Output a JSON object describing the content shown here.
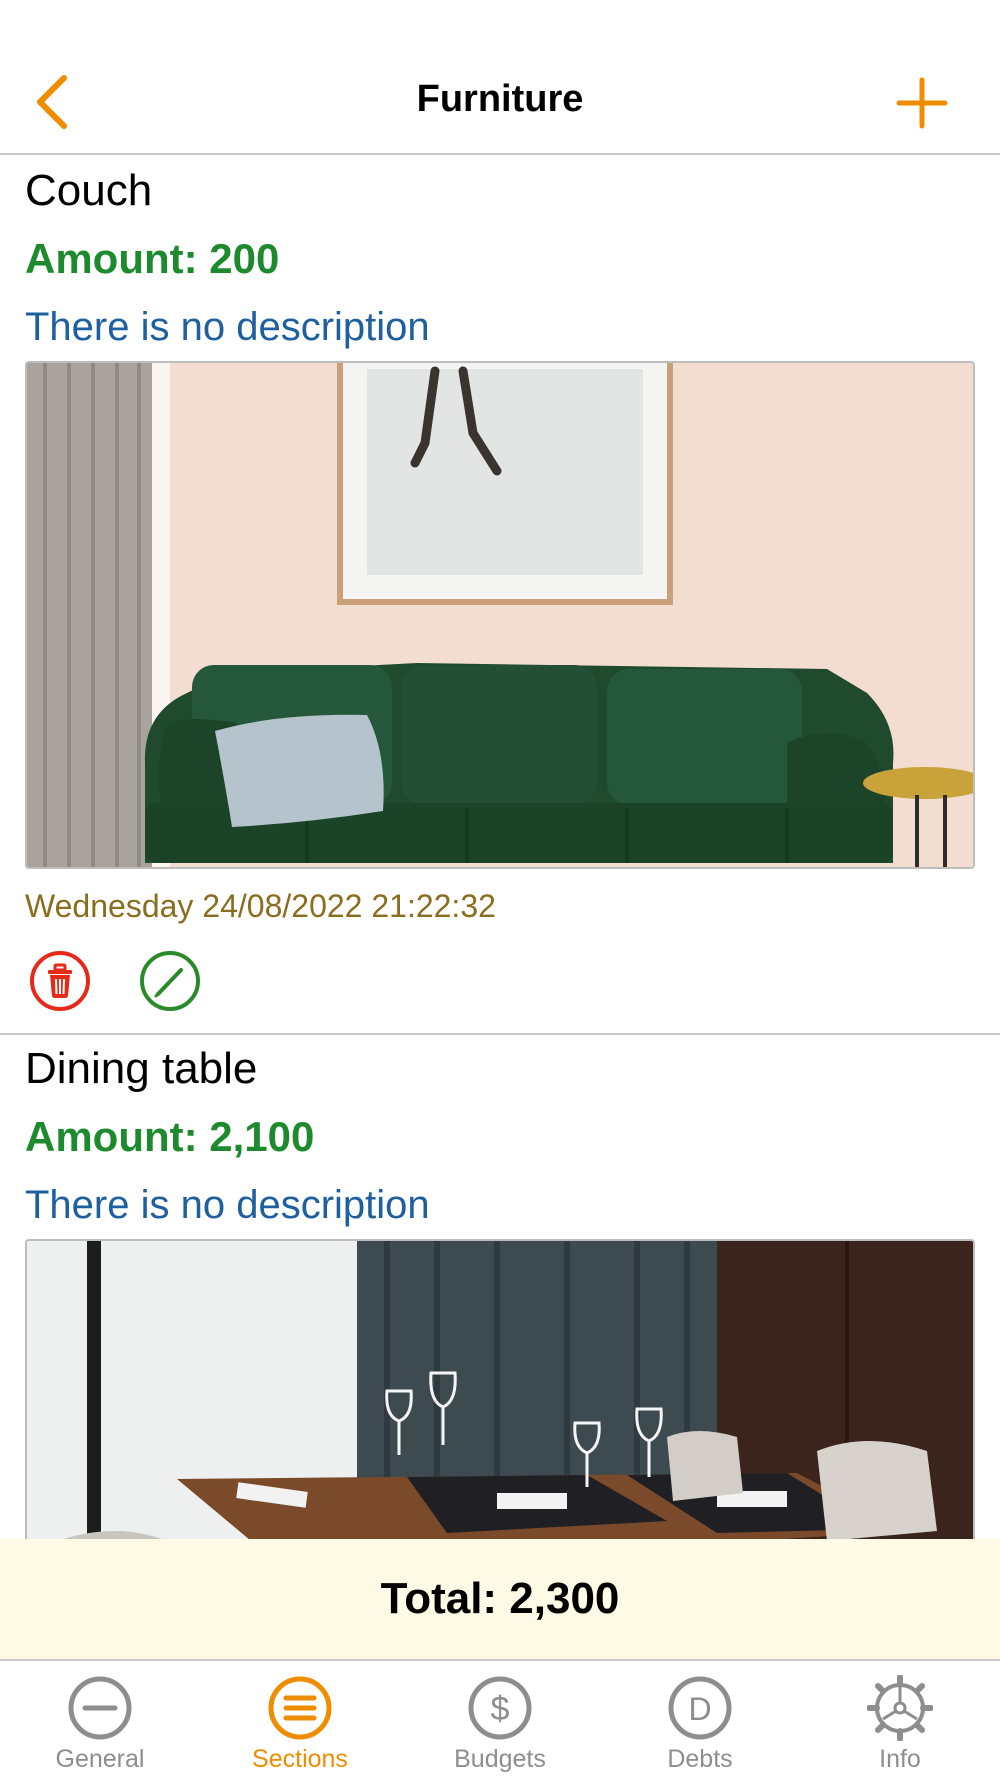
{
  "colors": {
    "accent": "#f08c00",
    "amount": "#1e8a2e",
    "description": "#1e5fa0",
    "date": "#8a6d1e",
    "delete": "#e52a1a",
    "edit": "#2a8a2a",
    "total_bg": "#fefae6",
    "tab_inactive": "#8e8e8e"
  },
  "nav": {
    "title": "Furniture",
    "back_icon": "chevron-left-icon",
    "add_icon": "plus-icon"
  },
  "items": [
    {
      "name": "Couch",
      "amount": "Amount: 200",
      "description": "There is no description",
      "photo": "green-velvet-couch-photo",
      "date": "Wednesday 24/08/2022 21:22:32"
    },
    {
      "name": "Dining table",
      "amount": "Amount: 2,100",
      "description": "There is no description",
      "photo": "dining-table-photo"
    }
  ],
  "total": "Total: 2,300",
  "tabs": [
    {
      "label": "General",
      "icon": "minus-circle-icon",
      "active": false
    },
    {
      "label": "Sections",
      "icon": "list-circle-icon",
      "active": true
    },
    {
      "label": "Budgets",
      "icon": "dollar-circle-icon",
      "active": false
    },
    {
      "label": "Debts",
      "icon": "d-circle-icon",
      "active": false
    },
    {
      "label": "Info",
      "icon": "gear-icon",
      "active": false
    }
  ]
}
